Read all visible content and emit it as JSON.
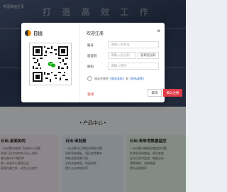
{
  "background": {
    "site_label": "中国桌面主页",
    "slogan": "打 造 高 效 工 作",
    "section_title": "• 产品中心 •",
    "cards": [
      {
        "title": "日出·桌面协同",
        "lines": [
          "一站式解决各部门协同办公问题",
          "多部门员工如何在平台上协同",
          "移动端与PC端同步",
          "统一消息中心管理企业",
          "高效沟通工作，成为企业助力"
        ]
      },
      {
        "title": "日出·审批报",
        "lines": [
          "一站式解决日常报表审批问题",
          "多种表单模板，满足各类需求",
          "审批流程清晰可视",
          "支持多级审批，快速流转",
          "提升企业审批效率"
        ]
      },
      {
        "title": "日出·表单考数据监控",
        "lines": [
          "一站式解决数据采集监控问题",
          "多类型表单数据，随时查看",
          "全方位实时监控，数据分析",
          "预警通知，消除隐患",
          "提升运营效率"
        ]
      }
    ]
  },
  "modal": {
    "brand_name": "日出",
    "title": "欢迎注册",
    "close_glyph": "×",
    "phone": {
      "label": "账号",
      "placeholder": "请输入手机号"
    },
    "code": {
      "label": "验证码",
      "placeholder": "请输入验证码",
      "button": "获取验证码"
    },
    "password": {
      "label": "密码",
      "placeholder": "请输入密码"
    },
    "agreement": {
      "prefix": "阅读并接受",
      "terms": "《服务条款》",
      "and": "和",
      "privacy": "《隐私政策》"
    },
    "login_link": "登录",
    "cancel_label": "取消",
    "confirm_label": "确认注册"
  },
  "colors": {
    "accent": "#e03a47",
    "link": "#2d6fd1",
    "brand_orange": "#f39200"
  }
}
